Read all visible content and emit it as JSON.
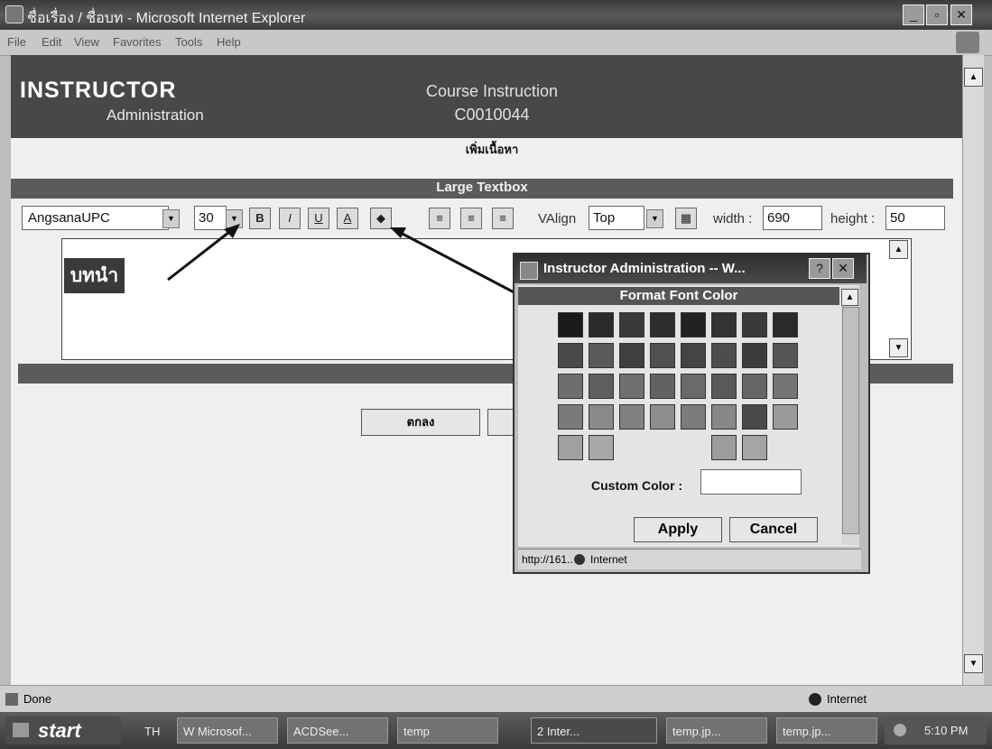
{
  "window": {
    "title": "ชื่อเรื่อง / ชื่อบท - Microsoft Internet Explorer"
  },
  "menu": [
    "File",
    "Edit",
    "View",
    "Favorites",
    "Tools",
    "Help"
  ],
  "header": {
    "logo_line1": "INSTRUCTOR",
    "logo_line2": "Administration",
    "title": "Course Instruction",
    "code": "C0010044"
  },
  "page_subtitle": "เพิ่มเนื้อหา",
  "section_title": "Large Textbox",
  "toolbar": {
    "font_value": "AngsanaUPC",
    "size_value": "30",
    "valign_label": "VAlign",
    "valign_value": "Top",
    "width_label": "width :",
    "width_value": "690",
    "height_label": "height :",
    "height_value": "50"
  },
  "editor": {
    "content_text": "บทนำ"
  },
  "form": {
    "ok_label": "ตกลง"
  },
  "popup": {
    "title": "Instructor Administration -- W...",
    "header": "Format Font Color",
    "custom_color_label": "Custom Color :",
    "custom_color_value": "",
    "apply_label": "Apply",
    "cancel_label": "Cancel",
    "status_url": "http://161..",
    "status_zone": "Internet",
    "swatches": [
      [
        "#1a1a1a",
        "#2b2b2b",
        "#3a3a3a",
        "#2e2e2e",
        "#222222",
        "#333333",
        "#3a3a3a",
        "#2a2a2a"
      ],
      [
        "#4a4a4a",
        "#5a5a5a",
        "#3f3f3f",
        "#505050",
        "#444444",
        "#4d4d4d",
        "#3c3c3c",
        "#565656"
      ],
      [
        "#6e6e6e",
        "#5e5e5e",
        "#707070",
        "#626262",
        "#6a6a6a",
        "#595959",
        "#666666",
        "#747474"
      ],
      [
        "#7a7a7a",
        "#8a8a8a",
        "#818181",
        "#8e8e8e",
        "#7c7c7c",
        "#888888",
        "#4a4a4a",
        "#9a9a9a"
      ],
      [
        "#a0a0a0",
        "#a8a8a8",
        "",
        "",
        "",
        "#9c9c9c",
        "#a5a5a5",
        ""
      ]
    ]
  },
  "statusbar": {
    "text": "Done",
    "zone": "Internet"
  },
  "taskbar": {
    "start": "start",
    "lang": "TH",
    "items": [
      "W Microsof...",
      "ACDSee...",
      "temp",
      "2 Inter...",
      "temp.jp...",
      "temp.jp..."
    ],
    "time": "5:10 PM"
  }
}
